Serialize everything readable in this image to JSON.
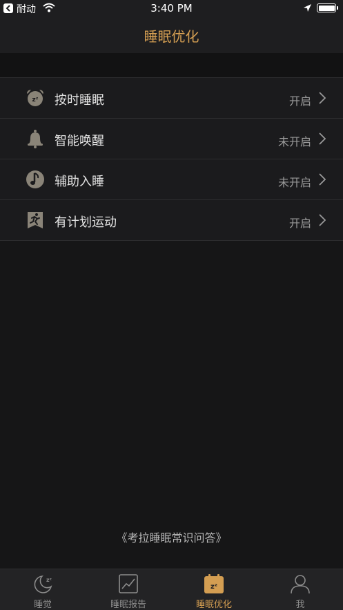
{
  "status_bar": {
    "back_app": "耐动",
    "time": "3:40 PM"
  },
  "nav": {
    "title": "睡眠优化"
  },
  "settings": [
    {
      "icon": "alarm-clock-icon",
      "label": "按时睡眠",
      "status": "开启"
    },
    {
      "icon": "bell-icon",
      "label": "智能唤醒",
      "status": "未开启"
    },
    {
      "icon": "music-note-icon",
      "label": "辅助入睡",
      "status": "未开启"
    },
    {
      "icon": "running-person-icon",
      "label": "有计划运动",
      "status": "开启"
    }
  ],
  "footer": {
    "link": "《考拉睡眠常识问答》"
  },
  "tabs": [
    {
      "icon": "moon-sleep-icon",
      "label": "睡觉",
      "active": false
    },
    {
      "icon": "chart-report-icon",
      "label": "睡眠报告",
      "active": false
    },
    {
      "icon": "calendar-sleep-icon",
      "label": "睡眠优化",
      "active": true
    },
    {
      "icon": "person-icon",
      "label": "我",
      "active": false
    }
  ],
  "colors": {
    "accent": "#d49e52",
    "background": "#161617",
    "row": "#1b1b1d"
  }
}
